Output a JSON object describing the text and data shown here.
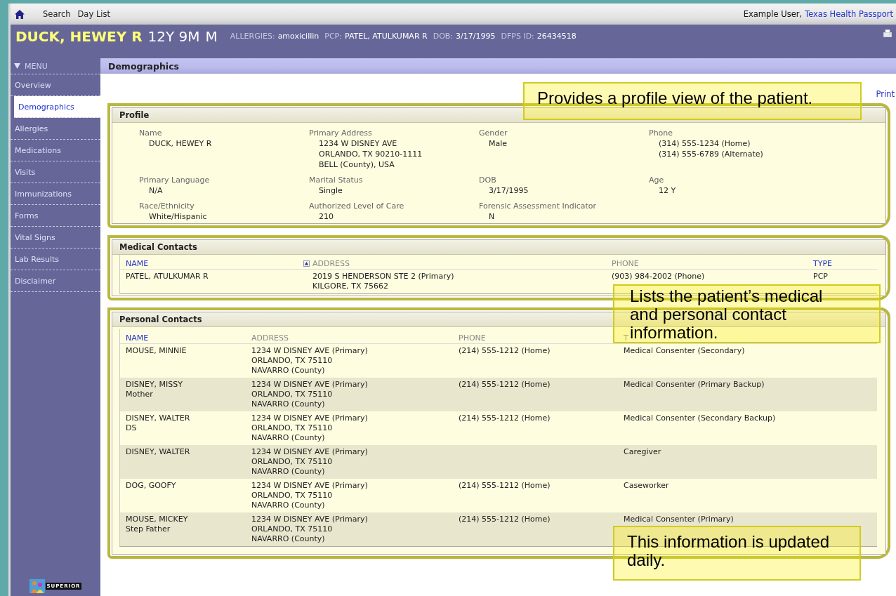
{
  "topbar": {
    "nav": [
      "Search",
      "Day List"
    ],
    "user": "Example User,",
    "org_link": "Texas Health Passport"
  },
  "patient": {
    "name": "DUCK, HEWEY R",
    "age": "12Y 9M",
    "sex": "M",
    "info": [
      {
        "label": "ALLERGIES:",
        "value": "amoxicillin"
      },
      {
        "label": "PCP:",
        "value": "PATEL, ATULKUMAR R"
      },
      {
        "label": "DOB:",
        "value": "3/17/1995"
      },
      {
        "label": "DFPS ID:",
        "value": "26434518"
      }
    ]
  },
  "sidebar": {
    "menu_label": "MENU",
    "items": [
      {
        "label": "Overview",
        "selected": false
      },
      {
        "label": "Demographics",
        "selected": true
      },
      {
        "label": "Allergies",
        "selected": false
      },
      {
        "label": "Medications",
        "selected": false
      },
      {
        "label": "Visits",
        "selected": false
      },
      {
        "label": "Immunizations",
        "selected": false
      },
      {
        "label": "Forms",
        "selected": false
      },
      {
        "label": "Vital Signs",
        "selected": false
      },
      {
        "label": "Lab Results",
        "selected": false
      },
      {
        "label": "Disclaimer",
        "selected": false
      }
    ],
    "logo_text": "SUPERIOR"
  },
  "page_title": "Demographics",
  "print_link": "Print",
  "profile": {
    "title": "Profile",
    "fields": [
      {
        "label": "Name",
        "lines": [
          "DUCK, HEWEY R"
        ]
      },
      {
        "label": "Primary Address",
        "lines": [
          "1234 W DISNEY AVE",
          "ORLANDO, TX 90210-1111",
          "BELL (County), USA"
        ]
      },
      {
        "label": "Gender",
        "lines": [
          "Male"
        ]
      },
      {
        "label": "Phone",
        "lines": [
          "(314) 555-1234 (Home)",
          "(314) 555-6789 (Alternate)"
        ]
      },
      {
        "label": "Primary Language",
        "lines": [
          "N/A"
        ]
      },
      {
        "label": "Marital Status",
        "lines": [
          "Single"
        ]
      },
      {
        "label": "DOB",
        "lines": [
          "3/17/1995"
        ]
      },
      {
        "label": "Age",
        "lines": [
          "12 Y"
        ]
      },
      {
        "label": "Race/Ethnicity",
        "lines": [
          "White/Hispanic"
        ]
      },
      {
        "label": "Authorized Level of Care",
        "lines": [
          "210"
        ]
      },
      {
        "label": "Forensic Assessment Indicator",
        "lines": [
          "N"
        ]
      }
    ]
  },
  "medical_contacts": {
    "title": "Medical Contacts",
    "columns": [
      {
        "label": "NAME",
        "link": true,
        "sorted": true
      },
      {
        "label": "ADDRESS",
        "link": false,
        "sorted": false
      },
      {
        "label": "PHONE",
        "link": false,
        "sorted": false
      },
      {
        "label": "TYPE",
        "link": true,
        "sorted": false
      }
    ],
    "rows": [
      {
        "cells": [
          [
            "PATEL, ATULKUMAR R"
          ],
          [
            "2019 S HENDERSON STE 2 (Primary)",
            "KILGORE, TX 75662"
          ],
          [
            "(903) 984-2002 (Phone)"
          ],
          [
            "PCP"
          ]
        ]
      }
    ]
  },
  "personal_contacts": {
    "title": "Personal Contacts",
    "columns": [
      {
        "label": "NAME",
        "link": true,
        "sorted": false
      },
      {
        "label": "ADDRESS",
        "link": false,
        "sorted": false
      },
      {
        "label": "PHONE",
        "link": false,
        "sorted": false
      },
      {
        "label": "T",
        "link": false,
        "sorted": false
      }
    ],
    "rows": [
      {
        "cells": [
          [
            "MOUSE, MINNIE"
          ],
          [
            "1234 W DISNEY AVE (Primary)",
            "ORLANDO, TX 75110",
            "NAVARRO (County)"
          ],
          [
            "(214) 555-1212 (Home)"
          ],
          [
            "Medical Consenter (Secondary)"
          ]
        ]
      },
      {
        "cells": [
          [
            "DISNEY, MISSY",
            "Mother"
          ],
          [
            "1234 W DISNEY AVE (Primary)",
            "ORLANDO, TX 75110",
            "NAVARRO (County)"
          ],
          [
            "(214) 555-1212 (Home)"
          ],
          [
            "Medical Consenter (Primary Backup)"
          ]
        ]
      },
      {
        "cells": [
          [
            "DISNEY, WALTER",
            "DS"
          ],
          [
            "1234 W DISNEY AVE (Primary)",
            "ORLANDO, TX 75110",
            "NAVARRO (County)"
          ],
          [
            "(214) 555-1212 (Home)"
          ],
          [
            "Medical Consenter (Secondary Backup)"
          ]
        ]
      },
      {
        "cells": [
          [
            "DISNEY, WALTER"
          ],
          [
            "1234 W DISNEY AVE (Primary)",
            "ORLANDO, TX 75110",
            "NAVARRO (County)"
          ],
          [],
          [
            "Caregiver"
          ]
        ]
      },
      {
        "cells": [
          [
            "DOG, GOOFY"
          ],
          [
            "1234 W DISNEY AVE (Primary)",
            "ORLANDO, TX 75110",
            "NAVARRO (County)"
          ],
          [
            "(214) 555-1212 (Home)"
          ],
          [
            "Caseworker"
          ]
        ]
      },
      {
        "cells": [
          [
            "MOUSE, MICKEY",
            "Step Father"
          ],
          [
            "1234 W DISNEY AVE (Primary)",
            "ORLANDO, TX 75110",
            "NAVARRO (County)"
          ],
          [
            "(214) 555-1212 (Home)"
          ],
          [
            "Medical Consenter (Primary)"
          ]
        ]
      }
    ]
  },
  "callouts": [
    {
      "text": "Provides a profile view of the patient."
    },
    {
      "text": "Lists the patient’s medical and personal contact information."
    },
    {
      "text": "This information is updated daily."
    }
  ]
}
